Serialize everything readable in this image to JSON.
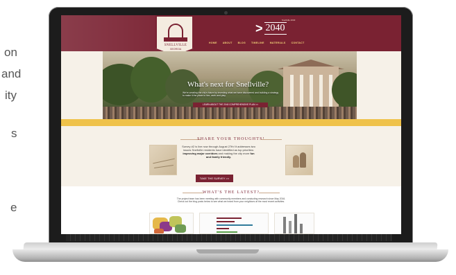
{
  "side_text": {
    "lines": [
      "on",
      "and",
      "ity",
      "s",
      "e"
    ]
  },
  "site": {
    "logo": {
      "name": "SNELLVILLE",
      "subtitle": "GEORGIA"
    },
    "brand": {
      "chevron": ">",
      "year": "2040",
      "tagline": "Snellville 2040"
    },
    "nav": [
      "HOME",
      "ABOUT",
      "BLOG",
      "TIMELINE",
      "MATERIALS",
      "CONTACT"
    ],
    "hero": {
      "title": "What's next for Snellville?",
      "subtitle": "We're creating the city's future by investing what we have discovered and building a strategy to make it the place to live, work and play.",
      "button": "LEARN ABOUT THE 2040 COMPREHENSIVE PLAN >>"
    },
    "thoughts": {
      "title": "SHARE YOUR THOUGHTS!",
      "body_1": "Survey #2 is live now through August 27th! It addresses two issues Snellville residents have identified as top priorities: ",
      "body_bold_1": "improving major corridors",
      "body_2": " and making the city more ",
      "body_bold_2": "fun and family friendly.",
      "button": "TAKE THE SURVEY >>"
    },
    "latest": {
      "title": "WHAT'S THE LATEST?",
      "body": "The project team has been meeting with community members and conducting research since May 2016. Check out the blog posts below to see what we heard from your neighbors at the most recent activities."
    }
  },
  "colors": {
    "brand_maroon": "#7a2232",
    "accent_yellow": "#efc24a",
    "page_cream": "#f6f1e8"
  }
}
